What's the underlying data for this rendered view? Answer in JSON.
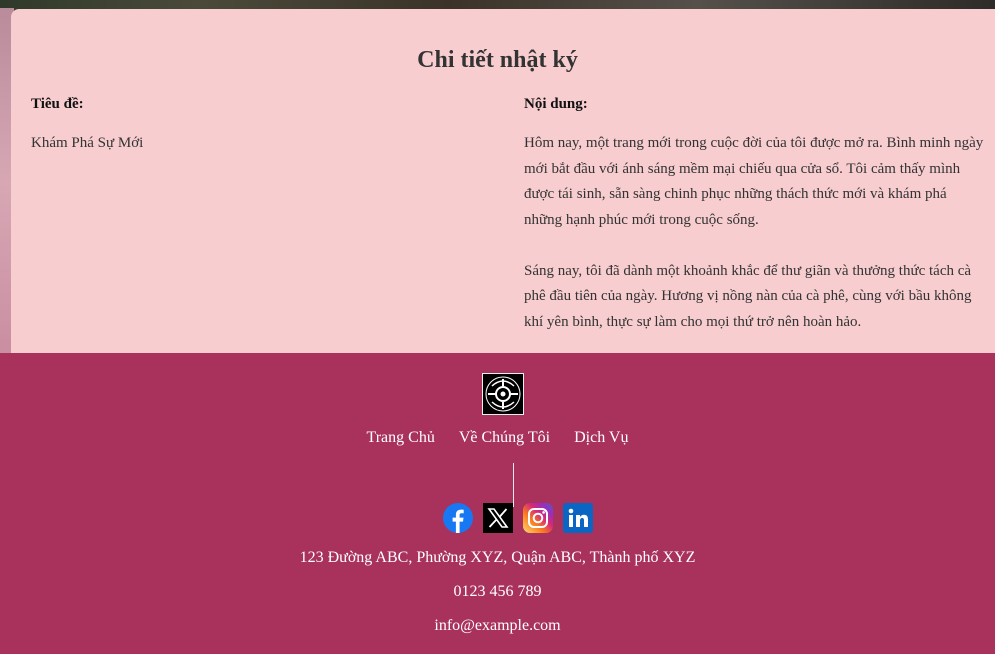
{
  "journal": {
    "title": "Chi tiết nhật ký",
    "title_label": "Tiêu đề:",
    "title_value": "Khám Phá Sự Mới",
    "content_label": "Nội dung:",
    "content_paragraphs": [
      "Hôm nay, một trang mới trong cuộc đời của tôi được mở ra. Bình minh ngày mới bắt đầu với ánh sáng mềm mại chiếu qua cửa sổ. Tôi cảm thấy mình được tái sinh, sẵn sàng chinh phục những thách thức mới và khám phá những hạnh phúc mới trong cuộc sống.",
      "Sáng nay, tôi đã dành một khoảnh khắc để thư giãn và thưởng thức tách cà phê đầu tiên của ngày. Hương vị nồng nàn của cà phê, cùng với bầu không khí yên bình, thực sự làm cho mọi thứ trở nên hoàn hảo."
    ]
  },
  "footer": {
    "nav": [
      "Trang Chủ",
      "Về Chúng Tôi",
      "Dịch Vụ"
    ],
    "social_icons": [
      "facebook-icon",
      "x-twitter-icon",
      "instagram-icon",
      "linkedin-icon"
    ],
    "address": "123 Đường ABC, Phường XYZ, Quận ABC, Thành phố XYZ",
    "phone": "0123 456 789",
    "email": "info@example.com"
  },
  "colors": {
    "card_bg": "#f7cdd0",
    "footer_bg": "#a8325b"
  }
}
